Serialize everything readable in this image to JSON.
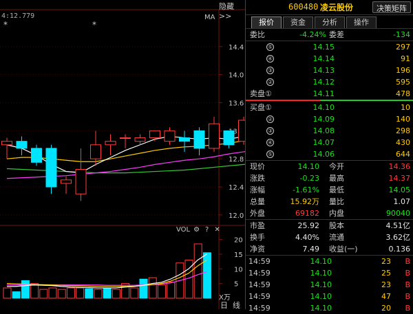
{
  "header": {
    "hide_label": "隐藏>>",
    "stock_code": "600480",
    "stock_name": "凌云股份",
    "decision_button": "决策矩阵"
  },
  "tabs": [
    {
      "label": "报价",
      "active": true
    },
    {
      "label": "资金",
      "active": false
    },
    {
      "label": "分析",
      "active": false
    },
    {
      "label": "操作",
      "active": false
    }
  ],
  "ratio": {
    "label1": "委比",
    "value1": "-4.24%",
    "label2": "委差",
    "value2": "-134"
  },
  "sell_book": [
    {
      "level": "⑤",
      "price": "14.15",
      "volume": "297"
    },
    {
      "level": "④",
      "price": "14.14",
      "volume": "91"
    },
    {
      "level": "③",
      "price": "14.13",
      "volume": "196"
    },
    {
      "level": "②",
      "price": "14.12",
      "volume": "595"
    },
    {
      "label": "卖盘①",
      "price": "14.11",
      "volume": "478"
    }
  ],
  "buy_book": [
    {
      "label": "买盘①",
      "price": "14.10",
      "volume": "10"
    },
    {
      "level": "②",
      "price": "14.09",
      "volume": "140"
    },
    {
      "level": "③",
      "price": "14.08",
      "volume": "298"
    },
    {
      "level": "④",
      "price": "14.07",
      "volume": "430"
    },
    {
      "level": "⑤",
      "price": "14.06",
      "volume": "644"
    }
  ],
  "quote": [
    {
      "l1": "现价",
      "v1": "14.10",
      "c1": "green",
      "l2": "今开",
      "v2": "14.36",
      "c2": "red"
    },
    {
      "l1": "涨跌",
      "v1": "-0.23",
      "c1": "green",
      "l2": "最高",
      "v2": "14.37",
      "c2": "red"
    },
    {
      "l1": "涨幅",
      "v1": "-1.61%",
      "c1": "green",
      "l2": "最低",
      "v2": "14.05",
      "c2": "green"
    },
    {
      "l1": "总量",
      "v1": "15.92万",
      "c1": "yellow",
      "l2": "量比",
      "v2": "1.07",
      "c2": "white"
    },
    {
      "l1": "外盘",
      "v1": "69182",
      "c1": "red",
      "l2": "内盘",
      "v2": "90040",
      "c2": "green"
    }
  ],
  "fundamentals": [
    {
      "l1": "市盈",
      "v1": "25.92",
      "l2": "股本",
      "v2": "4.51亿"
    },
    {
      "l1": "换手",
      "v1": "4.40%",
      "l2": "流通",
      "v2": "3.62亿"
    },
    {
      "l1": "净资",
      "v1": "7.49",
      "l2": "收益(一)",
      "v2": "0.136"
    }
  ],
  "trades": [
    {
      "time": "14:59",
      "price": "14.10",
      "vol": "23",
      "side": "B"
    },
    {
      "time": "14:59",
      "price": "14.10",
      "vol": "25",
      "side": "B"
    },
    {
      "time": "14:59",
      "price": "14.10",
      "vol": "23",
      "side": "B"
    },
    {
      "time": "14:59",
      "price": "14.10",
      "vol": "47",
      "side": "B"
    },
    {
      "time": "14:59",
      "price": "14.10",
      "vol": "20",
      "side": "B"
    }
  ],
  "chart": {
    "ma_readout": "4:12.779",
    "ma_label": "MA",
    "high_marker": "14.45",
    "price_ticks": [
      "14.4",
      "14.0",
      "13.6",
      "13.2",
      "12.8",
      "12.4",
      "12.0"
    ],
    "price_tick_values": [
      14.4,
      14.0,
      13.6,
      13.2,
      12.8,
      12.4,
      12.0
    ],
    "price_range": [
      11.95,
      14.75
    ],
    "vol_ticks": [
      "20",
      "15",
      "10",
      "5"
    ],
    "vol_tick_values": [
      20,
      15,
      10,
      5
    ],
    "vol_range": [
      0,
      22
    ],
    "vol_unit": "X万",
    "vol_label": "VOL",
    "bottom_tabs": [
      "日",
      "线"
    ],
    "up_color": "#ff3b3b",
    "down_color": "#00e5ff",
    "ma_colors": [
      "#ffffff",
      "#ffcc00",
      "#ff3bff",
      "#33cc33"
    ],
    "candles": [
      {
        "o": 13.0,
        "h": 13.1,
        "l": 12.8,
        "c": 13.05
      },
      {
        "o": 13.05,
        "h": 13.12,
        "l": 12.85,
        "c": 12.95
      },
      {
        "o": 12.95,
        "h": 13.0,
        "l": 12.7,
        "c": 12.75
      },
      {
        "o": 12.95,
        "h": 13.0,
        "l": 12.3,
        "c": 12.4
      },
      {
        "o": 12.45,
        "h": 12.55,
        "l": 12.3,
        "c": 12.5
      },
      {
        "o": 12.3,
        "h": 12.95,
        "l": 12.2,
        "c": 12.65
      },
      {
        "o": 12.8,
        "h": 13.2,
        "l": 12.7,
        "c": 13.0
      },
      {
        "o": 13.0,
        "h": 13.15,
        "l": 12.85,
        "c": 13.05
      },
      {
        "o": 13.1,
        "h": 13.15,
        "l": 12.95,
        "c": 13.1
      },
      {
        "o": 13.05,
        "h": 13.15,
        "l": 13.0,
        "c": 13.1
      },
      {
        "o": 13.1,
        "h": 13.2,
        "l": 13.05,
        "c": 13.2
      },
      {
        "o": 13.05,
        "h": 13.25,
        "l": 13.0,
        "c": 13.2
      },
      {
        "o": 13.1,
        "h": 13.2,
        "l": 12.9,
        "c": 13.05
      },
      {
        "o": 13.2,
        "h": 13.25,
        "l": 12.85,
        "c": 12.95
      },
      {
        "o": 12.95,
        "h": 13.4,
        "l": 12.9,
        "c": 13.3
      },
      {
        "o": 13.2,
        "h": 13.2,
        "l": 12.95,
        "c": 13.0
      },
      {
        "o": 13.05,
        "h": 13.4,
        "l": 13.0,
        "c": 13.35
      },
      {
        "o": 13.3,
        "h": 13.4,
        "l": 13.0,
        "c": 13.3
      },
      {
        "o": 13.3,
        "h": 13.4,
        "l": 13.0,
        "c": 13.05
      },
      {
        "o": 13.2,
        "h": 13.85,
        "l": 13.1,
        "c": 13.8
      },
      {
        "o": 13.7,
        "h": 14.45,
        "l": 13.65,
        "c": 14.35
      },
      {
        "o": 14.36,
        "h": 14.37,
        "l": 14.05,
        "c": 14.1
      }
    ],
    "volumes": [
      3.5,
      2.2,
      6.0,
      5.0,
      3.0,
      3.5,
      3.0,
      3.5,
      3.5,
      3.2,
      3.0,
      3.5,
      3.0,
      5.0,
      3.5,
      6.5,
      7.0,
      4.5,
      5.5,
      12.0,
      13.0,
      18.5,
      15.5
    ],
    "ma_vol_white": [
      4,
      4,
      4.3,
      4.5,
      4.4,
      4.3,
      4,
      3.8,
      3.7,
      3.6,
      3.5,
      3.5,
      3.5,
      3.8,
      4,
      4.4,
      5,
      5.4,
      6.5,
      8,
      10,
      13,
      15
    ],
    "ma_vol_yellow": [
      5,
      4.9,
      4.8,
      4.7,
      4.6,
      4.5,
      4.4,
      4.3,
      4.2,
      4.1,
      4,
      4,
      4,
      4,
      4.1,
      4.3,
      4.6,
      5,
      5.8,
      7,
      8.5,
      11,
      13
    ],
    "ma_vol_magenta": [
      4.5,
      4.5,
      4.5,
      4.5,
      4.5,
      4.5,
      4.5,
      4.5,
      4.5,
      4.5,
      4.5,
      4.4,
      4.4,
      4.4,
      4.4,
      4.5,
      4.6,
      4.8,
      5.2,
      6,
      6.8,
      8,
      9
    ],
    "ma5": [
      13.0,
      12.95,
      12.85,
      12.72,
      12.62,
      12.6,
      12.72,
      12.82,
      12.92,
      13.0,
      13.08,
      13.12,
      13.1,
      13.08,
      13.1,
      13.08,
      13.12,
      13.18,
      13.28,
      13.45,
      13.65,
      13.78
    ],
    "ma10": [
      12.8,
      12.82,
      12.82,
      12.8,
      12.78,
      12.76,
      12.76,
      12.8,
      12.84,
      12.88,
      12.92,
      12.95,
      12.97,
      12.98,
      13.0,
      13.02,
      13.06,
      13.1,
      13.18,
      13.26,
      13.36,
      13.45
    ],
    "ma20": [
      12.52,
      12.53,
      12.54,
      12.55,
      12.56,
      12.58,
      12.6,
      12.62,
      12.65,
      12.68,
      12.72,
      12.75,
      12.78,
      12.8,
      12.83,
      12.87,
      12.9,
      12.94,
      13.0,
      13.05,
      13.12,
      13.2
    ],
    "ma60": [
      12.66,
      12.65,
      12.64,
      12.63,
      12.62,
      12.61,
      12.6,
      12.6,
      12.6,
      12.61,
      12.62,
      12.63,
      12.64,
      12.66,
      12.68,
      12.7,
      12.72,
      12.75,
      12.78,
      12.82,
      12.86,
      12.9
    ]
  }
}
